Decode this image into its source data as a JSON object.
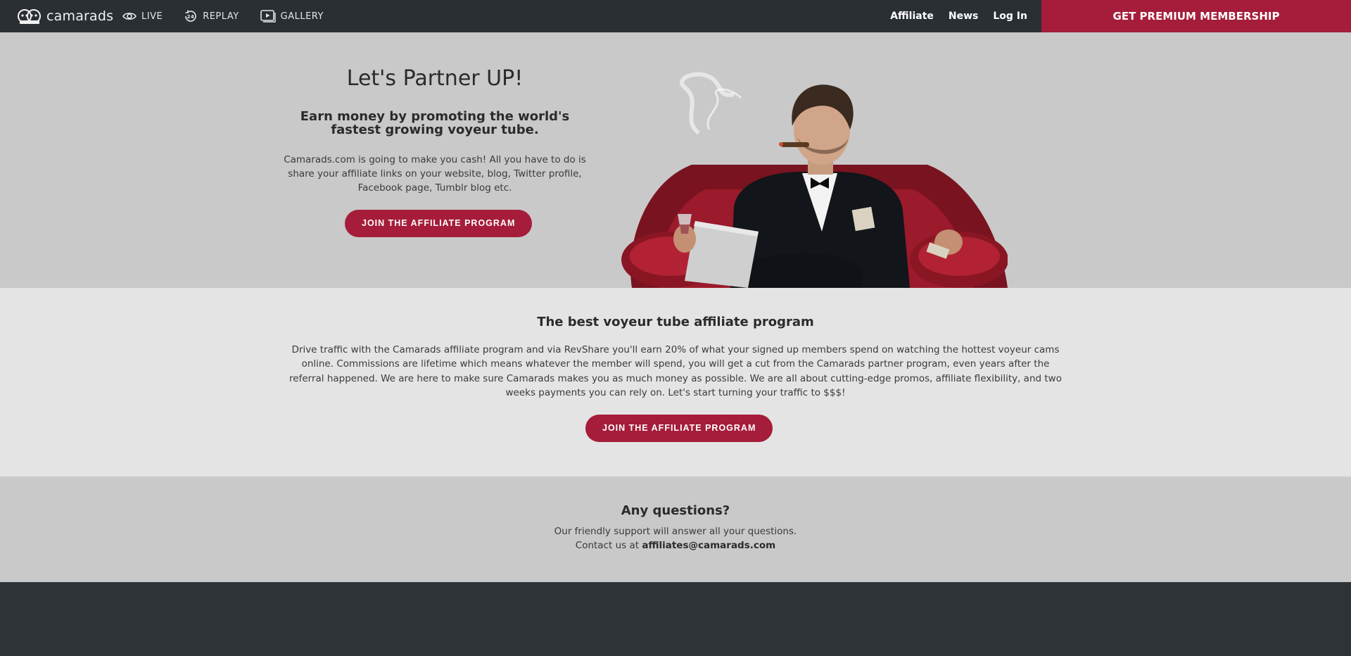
{
  "brand": {
    "name": "camarads"
  },
  "nav": {
    "left": [
      {
        "label": "LIVE",
        "icon": "eye-icon"
      },
      {
        "label": "REPLAY",
        "icon": "replay-24-icon"
      },
      {
        "label": "GALLERY",
        "icon": "play-gallery-icon"
      }
    ],
    "right": [
      "Affiliate",
      "News",
      "Log In"
    ],
    "premium_label": "GET PREMIUM MEMBERSHIP"
  },
  "hero": {
    "title": "Let's Partner UP!",
    "subtitle": "Earn money by promoting the world's fastest growing voyeur tube.",
    "description": "Camarads.com is going to make you cash! All you have to do is share your affiliate links on your website, blog, Twitter profile, Facebook page, Tumblr blog etc.",
    "button_label": "JOIN THE AFFILIATE PROGRAM"
  },
  "program": {
    "title": "The best voyeur tube affiliate program",
    "body": "Drive traffic with the Camarads affiliate program and via RevShare you'll earn 20% of what your signed up members spend on watching the hottest voyeur cams online. Commissions are lifetime which means whatever the member will spend, you will get a cut from the Camarads partner program, even years after the referral happened. We are here to make sure Camarads makes you as much money as possible. We are all about cutting-edge promos, affiliate flexibility, and two weeks payments you can rely on. Let's start turning your traffic to $$$!",
    "button_label": "JOIN THE AFFILIATE PROGRAM"
  },
  "questions": {
    "title": "Any questions?",
    "line1": "Our friendly support will answer all your questions.",
    "line2_prefix": "Contact us at ",
    "email": "affiliates@camarads.com"
  },
  "colors": {
    "navbar": "#2a2f34",
    "accent": "#a51d3a",
    "hero_bg": "#c9c9c9",
    "section_bg": "#e4e4e4",
    "footer": "#2e3338"
  }
}
